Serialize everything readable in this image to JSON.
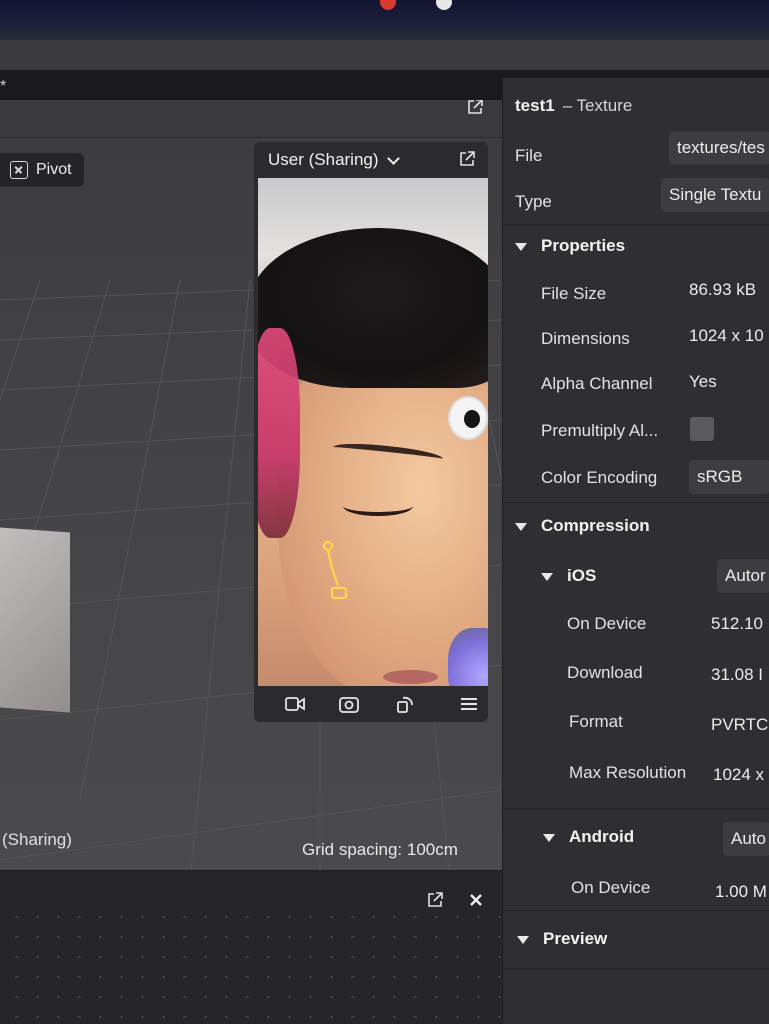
{
  "viewport": {
    "pivot_label": "Pivot",
    "sharing_label": "(Sharing)",
    "grid_spacing": "Grid spacing: 100cm"
  },
  "preview": {
    "device_label": "User (Sharing)"
  },
  "inspector": {
    "asset_name": "test1",
    "asset_type": "– Texture",
    "file_label": "File",
    "file_value": "textures/tes",
    "type_label": "Type",
    "type_value": "Single Textu",
    "properties": {
      "header": "Properties",
      "file_size_label": "File Size",
      "file_size_value": "86.93 kB",
      "dimensions_label": "Dimensions",
      "dimensions_value": "1024 x 10",
      "alpha_label": "Alpha Channel",
      "alpha_value": "Yes",
      "premultiply_label": "Premultiply Al...",
      "color_encoding_label": "Color Encoding",
      "color_encoding_value": "sRGB"
    },
    "compression": {
      "header": "Compression",
      "ios": {
        "header": "iOS",
        "mode": "Autor",
        "on_device_label": "On Device",
        "on_device_value": "512.10",
        "download_label": "Download",
        "download_value": "31.08 I",
        "format_label": "Format",
        "format_value": "PVRTC",
        "max_res_label": "Max Resolution",
        "max_res_value": "1024 x"
      },
      "android": {
        "header": "Android",
        "mode": "Auto",
        "on_device_label": "On Device",
        "on_device_value": "1.00 M"
      }
    },
    "preview_header": "Preview"
  },
  "icons": {
    "popout": "popout-icon",
    "close": "close-icon",
    "video": "video-camera-icon",
    "flip_camera": "flip-camera-icon",
    "rotate": "rotate-device-icon",
    "menu": "hamburger-menu-icon",
    "chevron": "chevron-down-icon"
  },
  "colors": {
    "inspector_bg": "#2f2f32",
    "viewport_bg": "#424245",
    "field_bg": "#3d3d40",
    "text": "#ececec"
  }
}
